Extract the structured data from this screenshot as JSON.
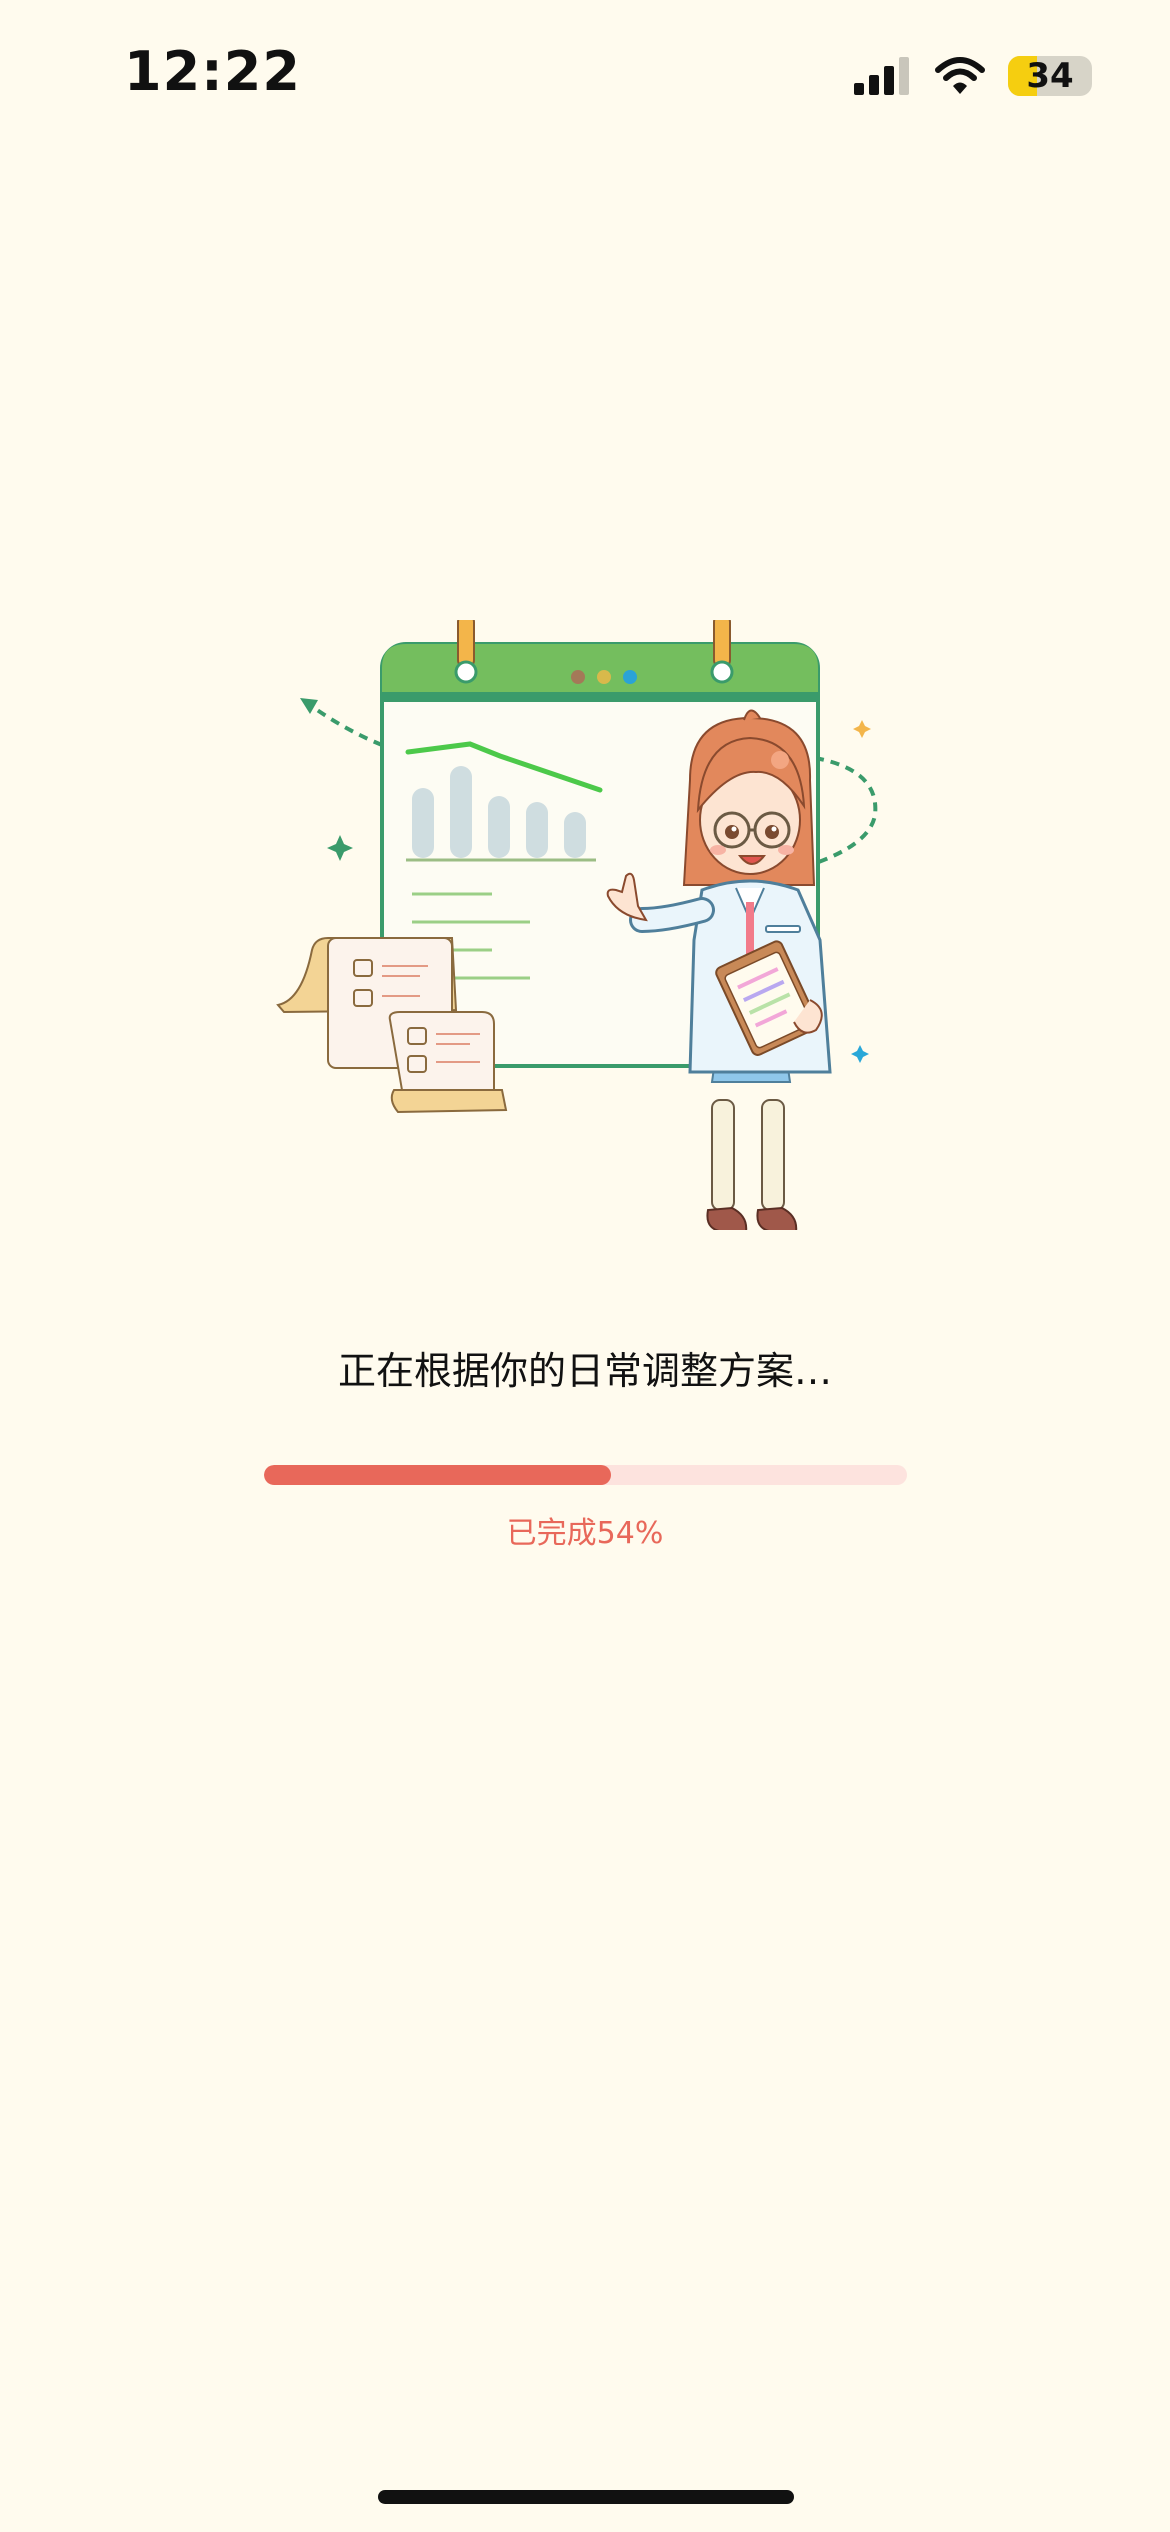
{
  "status_bar": {
    "time": "12:22",
    "battery_level": "34",
    "battery_fraction": 0.34,
    "icons": [
      "cellular-signal-icon",
      "wifi-icon",
      "battery-icon"
    ]
  },
  "loading": {
    "message": "正在根据你的日常调整方案…",
    "progress_fraction": 0.54,
    "progress_label": "已完成54%"
  },
  "colors": {
    "background": "#fffbee",
    "accent": "#e8685a",
    "track": "#fde3de",
    "illustration_green": "#74be5e"
  }
}
